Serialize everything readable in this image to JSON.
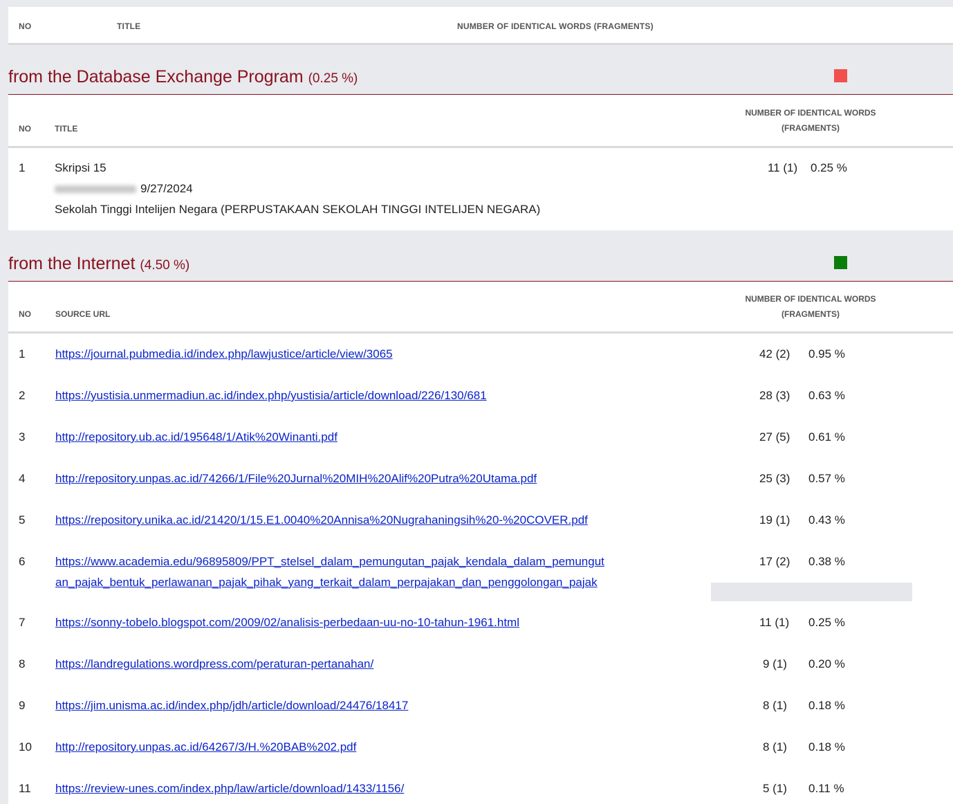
{
  "top_header": {
    "no": "NO",
    "title": "TITLE",
    "count": "NUMBER OF IDENTICAL WORDS (FRAGMENTS)"
  },
  "database": {
    "heading": "from the Database Exchange Program",
    "percent": "(0.25 %)",
    "swatch_color": "#f0514f",
    "columns": {
      "no": "NO",
      "title": "TITLE",
      "count_line1": "NUMBER OF IDENTICAL WORDS",
      "count_line2": "(FRAGMENTS)"
    },
    "rows": [
      {
        "no": "1",
        "title": "Skripsi 15",
        "date": "9/27/2024",
        "institution": "Sekolah Tinggi Intelijen Negara (PERPUSTAKAAN SEKOLAH TINGGI INTELIJEN NEGARA)",
        "count": "11 (1)",
        "pct": "0.25 %"
      }
    ]
  },
  "internet": {
    "heading": "from the Internet",
    "percent": "(4.50 %)",
    "swatch_color": "#0c7d0c",
    "columns": {
      "no": "NO",
      "source": "SOURCE URL",
      "count_line1": "NUMBER OF IDENTICAL WORDS",
      "count_line2": "(FRAGMENTS)"
    },
    "rows": [
      {
        "no": "1",
        "url": "https://journal.pubmedia.id/index.php/lawjustice/article/view/3065",
        "count": "42 (2)",
        "pct": "0.95 %"
      },
      {
        "no": "2",
        "url": "https://yustisia.unmermadiun.ac.id/index.php/yustisia/article/download/226/130/681",
        "count": "28 (3)",
        "pct": "0.63 %"
      },
      {
        "no": "3",
        "url": "http://repository.ub.ac.id/195648/1/Atik%20Winanti.pdf",
        "count": "27 (5)",
        "pct": "0.61 %"
      },
      {
        "no": "4",
        "url": "http://repository.unpas.ac.id/74266/1/File%20Jurnal%20MIH%20Alif%20Putra%20Utama.pdf",
        "count": "25 (3)",
        "pct": "0.57 %"
      },
      {
        "no": "5",
        "url": "https://repository.unika.ac.id/21420/1/15.E1.0040%20Annisa%20Nugrahaningsih%20-%20COVER.pdf",
        "count": "19 (1)",
        "pct": "0.43 %"
      },
      {
        "no": "6",
        "url_line1": "https://www.academia.edu/96895809/PPT_stelsel_dalam_pemungutan_pajak_kendala_dalam_pemungut",
        "url_line2": "an_pajak_bentuk_perlawanan_pajak_pihak_yang_terkait_dalam_perpajakan_dan_penggolongan_pajak",
        "count": "17 (2)",
        "pct": "0.38 %"
      },
      {
        "no": "7",
        "url": "https://sonny-tobelo.blogspot.com/2009/02/analisis-perbedaan-uu-no-10-tahun-1961.html",
        "count": "11 (1)",
        "pct": "0.25 %"
      },
      {
        "no": "8",
        "url": "https://landregulations.wordpress.com/peraturan-pertanahan/",
        "count": "9 (1)",
        "pct": "0.20 %"
      },
      {
        "no": "9",
        "url": "https://jim.unisma.ac.id/index.php/jdh/article/download/24476/18417",
        "count": "8 (1)",
        "pct": "0.18 %"
      },
      {
        "no": "10",
        "url": "http://repository.unpas.ac.id/64267/3/H.%20BAB%202.pdf",
        "count": "8 (1)",
        "pct": "0.18 %"
      },
      {
        "no": "11",
        "url": "https://review-unes.com/index.php/law/article/download/1433/1156/",
        "count": "5 (1)",
        "pct": "0.11 %"
      }
    ]
  }
}
